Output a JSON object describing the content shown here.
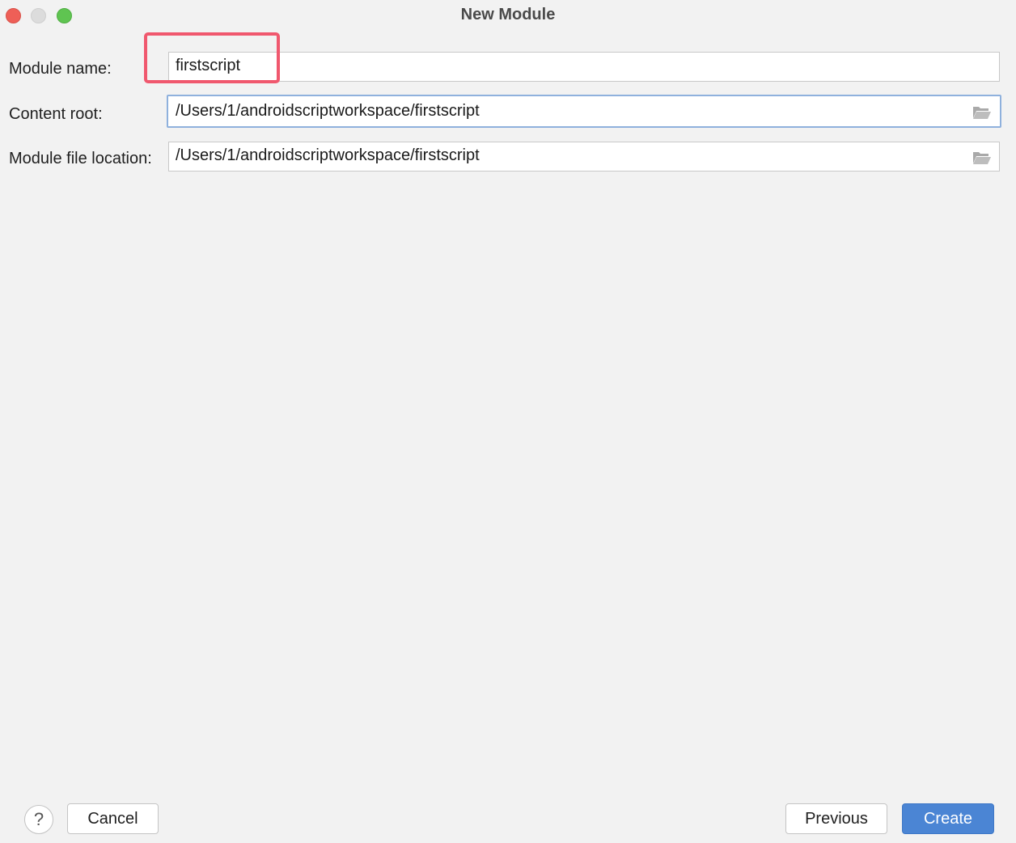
{
  "window": {
    "title": "New Module"
  },
  "form": {
    "module_name": {
      "label": "Module name:",
      "value": "firstscript"
    },
    "content_root": {
      "label": "Content root:",
      "value": "/Users/1/androidscriptworkspace/firstscript",
      "icon": "folder-open-icon"
    },
    "module_file_location": {
      "label": "Module file location:",
      "value": "/Users/1/androidscriptworkspace/firstscript",
      "icon": "folder-open-icon"
    }
  },
  "footer": {
    "help_label": "?",
    "cancel_label": "Cancel",
    "previous_label": "Previous",
    "create_label": "Create"
  },
  "colors": {
    "highlight": "#f0586e",
    "primary_button": "#4b85d4",
    "focus_ring": "#8fb1dd",
    "window_bg": "#f2f2f2"
  }
}
